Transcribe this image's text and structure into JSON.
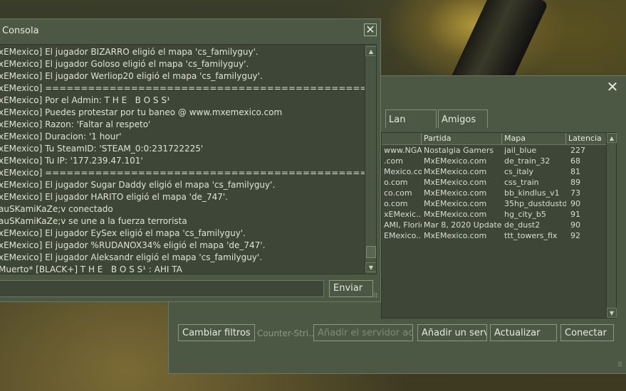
{
  "console": {
    "title": "Consola",
    "close": "✕",
    "lines": [
      "xEMexico] El jugador BIZARRO eligió el mapa 'cs_familyguy'.",
      "xEMexico] El jugador Goloso eligió el mapa 'cs_familyguy'.",
      "xEMexico] El jugador Werliop20 eligió el mapa 'cs_familyguy'.",
      "xEMexico] ==============================================",
      "xEMexico] Por el Admin: T H E   B O S S¹",
      "xEMexico] Puedes protestar por tu baneo @ www.mxemexico.com",
      "xEMexico] Razon: 'Faltar al respeto'",
      "xEMexico] Duracion: '1 hour'",
      "xEMexico] Tu SteamID: 'STEAM_0:0:231722225'",
      "xEMexico] Tu IP: '177.239.47.101'",
      "xEMexico] ==============================================",
      "xEMexico] El jugador Sugar Daddy eligió el mapa 'cs_familyguy'.",
      "xEMexico] El jugador HARITO eligió el mapa 'de_747'.",
      "auSKamiKaZe;v conectado",
      "auSKamiKaZe;v se une a la fuerza terrorista",
      "xEMexico] El jugador EySex eligió el mapa 'cs_familyguy'.",
      "xEMexico] El jugador %RUDANOX34% eligió el mapa 'de_747'.",
      "xEMexico] El jugador Aleksandr eligió el mapa 'cs_familyguy'.",
      "Muerto* [BLACK+] T H E   B O S S¹ : AHI TA"
    ],
    "input_value": "",
    "send_label": "Enviar"
  },
  "browser": {
    "close": "✕",
    "tabs": [
      "Lan",
      "Amigos"
    ],
    "columns": [
      "",
      "Partida",
      "Mapa",
      "Latencia"
    ],
    "rows": [
      {
        "name": "www.NGA..",
        "partida": "Nostalgia Gamers",
        "mapa": "jail_blue",
        "latencia": "227"
      },
      {
        "name": ".com",
        "partida": "MxEMexico.com",
        "mapa": "de_train_32",
        "latencia": "68"
      },
      {
        "name": "Mexico.com",
        "partida": "MxEMexico.com",
        "mapa": "cs_italy",
        "latencia": "81"
      },
      {
        "name": "o.com",
        "partida": "MxEMexico.com",
        "mapa": "css_train",
        "latencia": "89"
      },
      {
        "name": "co.com",
        "partida": "MxEMexico.com",
        "mapa": "bb_kindlus_v1",
        "latencia": "73"
      },
      {
        "name": "o.com",
        "partida": "MxEMexico.com",
        "mapa": "35hp_dustdustd..",
        "latencia": "90"
      },
      {
        "name": "xEMexic..",
        "partida": "MxEMexico.com",
        "mapa": "hg_city_b5",
        "latencia": "91"
      },
      {
        "name": "AMI, Florida",
        "partida": "Mar 8, 2020 Update",
        "mapa": "de_dust2",
        "latencia": "90"
      },
      {
        "name": "EMexico....",
        "partida": "MxEMexico.com",
        "mapa": "ttt_towers_fix",
        "latencia": "92"
      }
    ],
    "buttons": {
      "cambiar": "Cambiar filtros",
      "counter": "Counter-Stri...",
      "anadir_actual": "Añadir el servidor actual",
      "anadir": "Añadir un servi...",
      "actualizar": "Actualizar",
      "conectar": "Conectar"
    }
  }
}
